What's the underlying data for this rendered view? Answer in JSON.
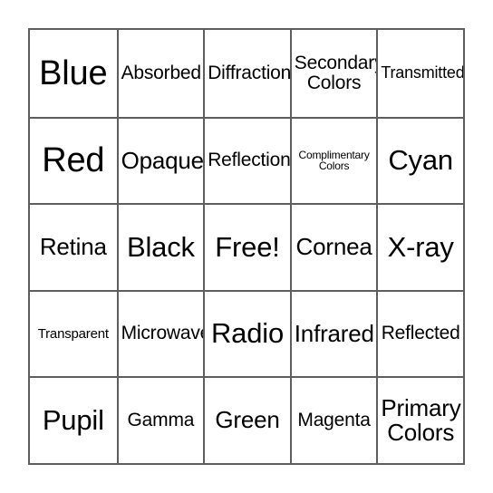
{
  "card": {
    "type": "bingo-card",
    "rows": 5,
    "columns": 5,
    "free_space_label": "Free!",
    "background_color": "#ffffff",
    "border_color": "#5e5e5e",
    "text_color": "#000000",
    "cells": [
      [
        {
          "label": "Blue",
          "size": "fs-xxl"
        },
        {
          "label": "Absorbed",
          "size": "fs-m"
        },
        {
          "label": "Diffraction",
          "size": "fs-m"
        },
        {
          "label": "Secondary Colors",
          "size": "fs-m"
        },
        {
          "label": "Transmitted",
          "size": "fs-s"
        }
      ],
      [
        {
          "label": "Red",
          "size": "fs-xxl"
        },
        {
          "label": "Opaque",
          "size": "fs-l"
        },
        {
          "label": "Reflection",
          "size": "fs-m"
        },
        {
          "label": "Complimentary Colors",
          "size": "fs-xxs"
        },
        {
          "label": "Cyan",
          "size": "fs-xl"
        }
      ],
      [
        {
          "label": "Retina",
          "size": "fs-l"
        },
        {
          "label": "Black",
          "size": "fs-xl"
        },
        {
          "label": "Free!",
          "size": "fs-xl"
        },
        {
          "label": "Cornea",
          "size": "fs-l"
        },
        {
          "label": "X-ray",
          "size": "fs-xl"
        }
      ],
      [
        {
          "label": "Transparent",
          "size": "fs-xs"
        },
        {
          "label": "Microwave",
          "size": "fs-m"
        },
        {
          "label": "Radio",
          "size": "fs-xl"
        },
        {
          "label": "Infrared",
          "size": "fs-l"
        },
        {
          "label": "Reflected",
          "size": "fs-m"
        }
      ],
      [
        {
          "label": "Pupil",
          "size": "fs-xl"
        },
        {
          "label": "Gamma",
          "size": "fs-m"
        },
        {
          "label": "Green",
          "size": "fs-l"
        },
        {
          "label": "Magenta",
          "size": "fs-m"
        },
        {
          "label": "Primary Colors",
          "size": "fs-l"
        }
      ]
    ]
  }
}
